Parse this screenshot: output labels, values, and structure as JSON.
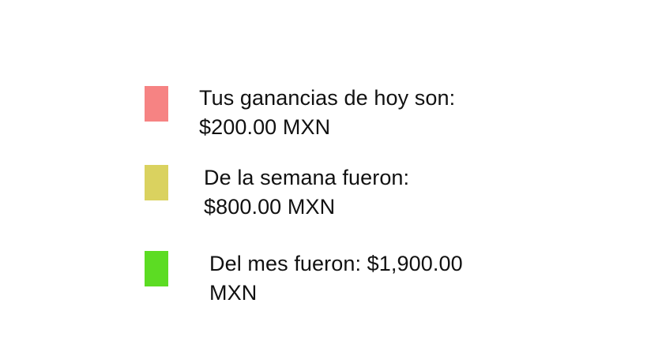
{
  "legend": {
    "items": [
      {
        "color": "#f68383",
        "line1": "Tus ganancias de hoy son:",
        "line2": "$200.00 MXN"
      },
      {
        "color": "#dad25f",
        "line1": "De la semana fueron:",
        "line2": "$800.00 MXN"
      },
      {
        "color": "#5cdc23",
        "line1": "Del mes fueron: $1,900.00",
        "line2": "MXN"
      }
    ]
  }
}
